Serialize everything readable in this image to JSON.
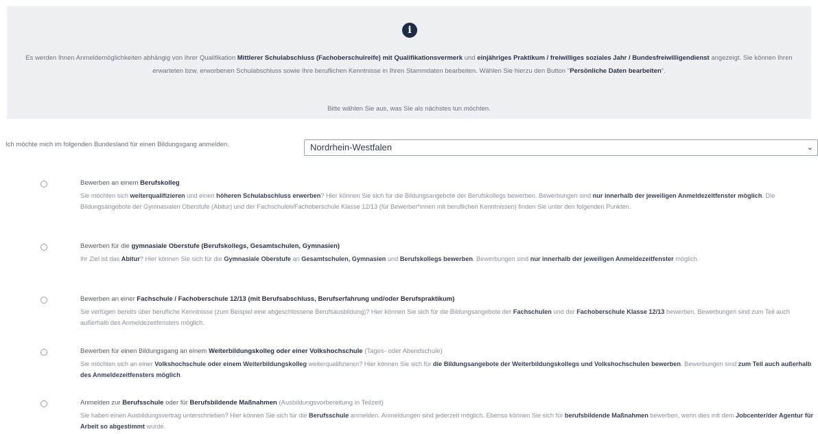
{
  "info": {
    "icon": "info-icon",
    "text_parts": [
      "Es werden Ihnen Anmeldemöglichkeiten abhängig von Ihrer Qualifikation ",
      "Mittlerer Schulabschluss (Fachoberschulreife) mit Qualifikationsvermerk",
      " und ",
      "einjähriges Praktikum / freiwilliges soziales Jahr / Bundesfreiwilligendienst",
      " angezeigt. Sie können Ihren erwarteten bzw. erworbenen Schulabschluss sowie Ihre beruflichen Kenntnisse in Ihren Stammdaten bearbeiten. Wählen Sie hierzu den Button \"",
      "Persönliche Daten bearbeiten",
      "\"."
    ],
    "prompt": "Bitte wählen Sie aus, was Sie als nächstes tun möchten."
  },
  "state": {
    "label": "Ich möchte mich im folgenden Bundesland für einen Bildungsgang anmelden.",
    "selected": "Nordrhein-Westfalen"
  },
  "options": [
    {
      "title": [
        "Bewerben an einem ",
        "Berufskolleg",
        ""
      ],
      "desc": [
        "Sie möchten sich ",
        "weiterqualifizieren",
        " und einen ",
        "höheren Schulabschluss erwerben",
        "? Hier können Sie sich für die Bildungsangebote der Berufskollegs bewerben. Bewerbungen sind ",
        "nur innerhalb der jeweiligen Anmeldezeitfenster möglich",
        ". Die Bildungsangebote der Gymnasialen Oberstufe (Abitur) und der Fachschulen/Fachoberschule Klasse 12/13 (für Bewerber*innen mit beruflichen Kenntnissen) finden Sie unter den folgenden Punkten."
      ]
    },
    {
      "title": [
        "Bewerben für die ",
        "gymnasiale Oberstufe (Berufskollegs, Gesamtschulen, Gymnasien)",
        ""
      ],
      "desc": [
        "Ihr Ziel ist das ",
        "Abitur",
        "? Hier können Sie sich für die ",
        "Gymnasiale Oberstufe",
        " an ",
        "Gesamtschulen, Gymnasien",
        " und ",
        "Berufskollegs bewerben",
        ". Bewerbungen sind ",
        "nur innerhalb der jeweiligen Anmeldezeitfenster",
        " möglich."
      ]
    },
    {
      "title": [
        "Bewerben an einer ",
        "Fachschule / Fachoberschule 12/13 (mit Berufsabschluss, Berufserfahrung und/oder Berufspraktikum)",
        ""
      ],
      "desc": [
        "Sie verfügen bereits über berufliche Kenntnisse (zum Beispiel eine abgeschlossene Berufsausbildung)? Hier können Sie sich für die Bildungsangebote der ",
        "Fachschulen",
        " und der ",
        "Fachoberschule Klasse 12/13",
        " bewerben. Bewerbungen sind zum Teil auch außerhalb des Anmeldezeitfensters möglich."
      ]
    },
    {
      "title": [
        "Bewerben für einen Bildungsgang an einem ",
        "Weiterbildungskolleg oder einer Volkshochschule",
        " (Tages- oder Abendschule)"
      ],
      "desc": [
        "Sie möchten sich an einer ",
        "Volkshochschule oder einem Weiterbildungskolleg",
        " weiterqualifizieren? Hier können Sie sich für ",
        "die Bildungsangebote der Weiterbildungskollegs und Volkshochschulen bewerben",
        ". Bewerbungen sind ",
        "zum Teil auch außerhalb des Anmeldezeitfensters möglich",
        "."
      ]
    },
    {
      "title": [
        "Anmelden zur ",
        "Berufsschule",
        " oder für ",
        "Berufsbildende Maßnahmen",
        " (Ausbildungsvorbereitung in Teilzeit)"
      ],
      "desc": [
        "Sie haben einen Ausbildungsvertrag unterschrieben? Hier können Sie sich für die ",
        "Berufsschule",
        " anmelden. Anmeldungen sind jederzeit möglich. Ebenso können Sie sich für ",
        "berufsbildende Maßnahmen",
        " bewerben, wenn dies mit dem ",
        "Jobcenter/der Agentur für Arbeit so abgestimmt",
        " wurde."
      ]
    }
  ]
}
